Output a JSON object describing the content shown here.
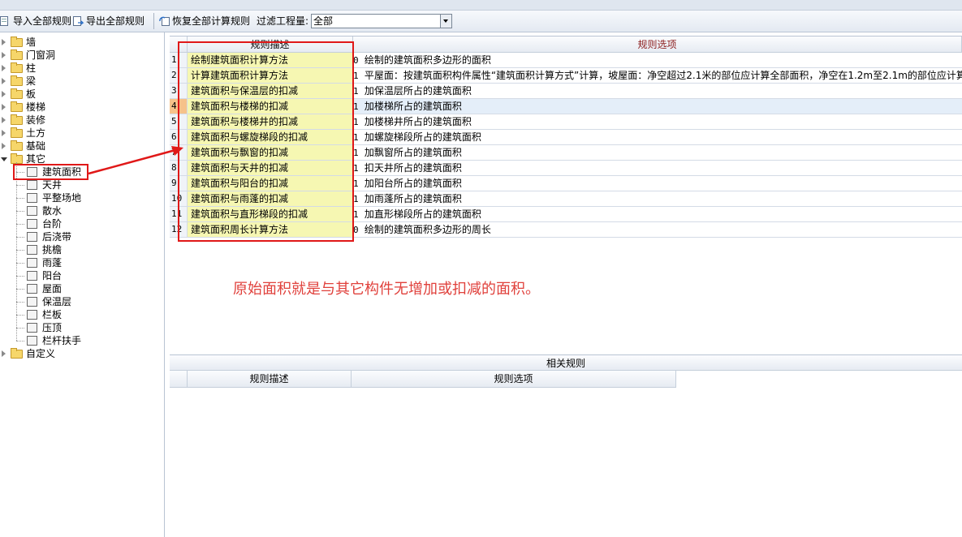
{
  "toolbar": {
    "import_label": "导入全部规则",
    "export_label": "导出全部规则",
    "restore_label": "恢复全部计算规则",
    "filter_label": "过滤工程量:",
    "filter_value": "全部"
  },
  "tree": {
    "folders_top": [
      "墙",
      "门窗洞",
      "柱",
      "梁",
      "板",
      "楼梯",
      "装修",
      "土方",
      "基础"
    ],
    "other_folder": "其它",
    "other_children": [
      "建筑面积",
      "天井",
      "平整场地",
      "散水",
      "台阶",
      "后浇带",
      "挑檐",
      "雨蓬",
      "阳台",
      "屋面",
      "保温层",
      "栏板",
      "压顶",
      "栏杆扶手"
    ],
    "custom_folder": "自定义"
  },
  "rules": {
    "header_desc": "规则描述",
    "header_options": "规则选项",
    "rows": [
      {
        "no": "1",
        "desc": "绘制建筑面积计算方法",
        "code": "0",
        "option": "绘制的建筑面积多边形的面积"
      },
      {
        "no": "2",
        "desc": "计算建筑面积计算方法",
        "code": "1",
        "option": "平屋面：按建筑面积构件属性“建筑面积计算方式”计算，坡屋面：净空超过2.1米的部位应计算全部面积，净空在1.2m至2.1m的部位应计算"
      },
      {
        "no": "3",
        "desc": "建筑面积与保温层的扣减",
        "code": "1",
        "option": "加保温层所占的建筑面积"
      },
      {
        "no": "4",
        "desc": "建筑面积与楼梯的扣减",
        "code": "1",
        "option": "加楼梯所占的建筑面积"
      },
      {
        "no": "5",
        "desc": "建筑面积与楼梯井的扣减",
        "code": "1",
        "option": "加楼梯井所占的建筑面积"
      },
      {
        "no": "6",
        "desc": "建筑面积与螺旋梯段的扣减",
        "code": "1",
        "option": "加螺旋梯段所占的建筑面积"
      },
      {
        "no": "7",
        "desc": "建筑面积与飘窗的扣减",
        "code": "1",
        "option": "加飘窗所占的建筑面积"
      },
      {
        "no": "8",
        "desc": "建筑面积与天井的扣减",
        "code": "1",
        "option": "扣天井所占的建筑面积"
      },
      {
        "no": "9",
        "desc": "建筑面积与阳台的扣减",
        "code": "1",
        "option": "加阳台所占的建筑面积"
      },
      {
        "no": "10",
        "desc": "建筑面积与雨蓬的扣减",
        "code": "1",
        "option": "加雨蓬所占的建筑面积"
      },
      {
        "no": "11",
        "desc": "建筑面积与直形梯段的扣减",
        "code": "1",
        "option": "加直形梯段所占的建筑面积"
      },
      {
        "no": "12",
        "desc": "建筑面积周长计算方法",
        "code": "0",
        "option": "绘制的建筑面积多边形的周长"
      }
    ]
  },
  "annotation": "原始面积就是与其它构件无增加或扣减的面积。",
  "related": {
    "title": "相关规则",
    "header_desc": "规则描述",
    "header_options": "规则选项"
  },
  "colors": {
    "highlight": "#e01818",
    "annotation": "#e0413c",
    "desc_cell": "#f6f7b2",
    "selected_row": "#e4eef9"
  }
}
